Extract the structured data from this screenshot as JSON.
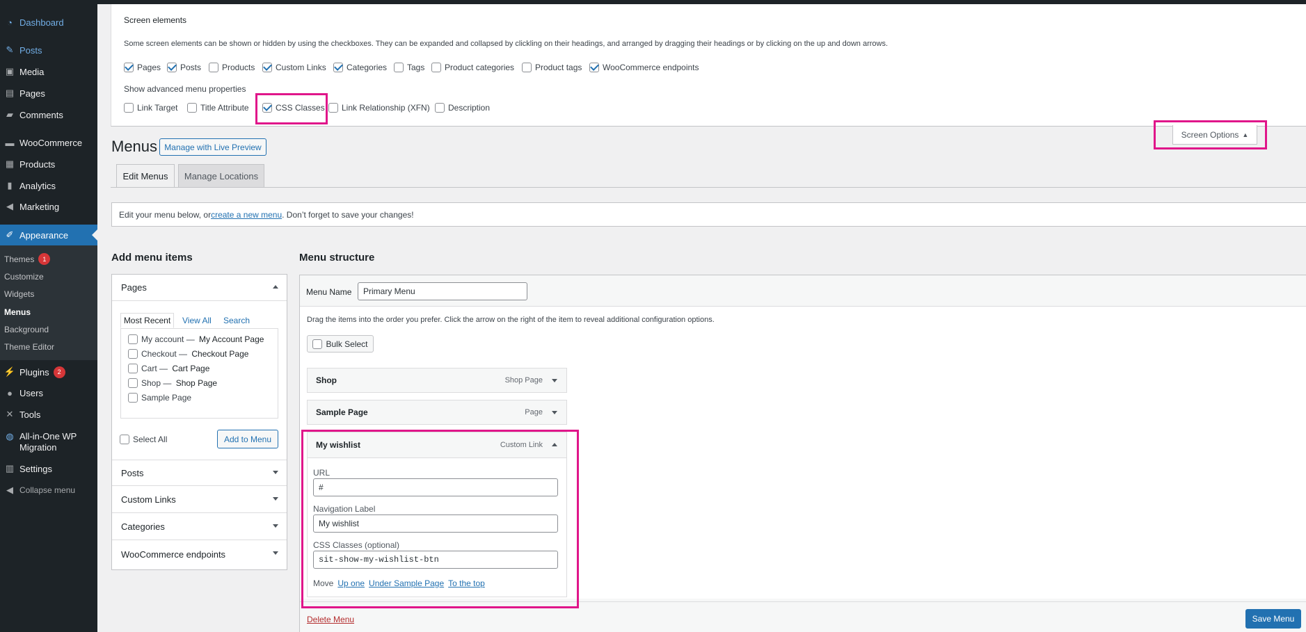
{
  "sidebar": {
    "items": [
      {
        "label": "Dashboard",
        "icon": "dashboard-icon"
      },
      {
        "label": "Posts",
        "icon": "pin-icon"
      },
      {
        "label": "Media",
        "icon": "media-icon"
      },
      {
        "label": "Pages",
        "icon": "pages-icon"
      },
      {
        "label": "Comments",
        "icon": "comment-icon"
      },
      {
        "label": "WooCommerce",
        "icon": "woo-icon"
      },
      {
        "label": "Products",
        "icon": "archive-icon"
      },
      {
        "label": "Analytics",
        "icon": "chart-icon"
      },
      {
        "label": "Marketing",
        "icon": "megaphone-icon"
      },
      {
        "label": "Appearance",
        "icon": "brush-icon"
      },
      {
        "label": "Plugins",
        "icon": "plugin-icon",
        "badge": "2"
      },
      {
        "label": "Users",
        "icon": "user-icon"
      },
      {
        "label": "Tools",
        "icon": "wrench-icon"
      },
      {
        "label": "All-in-One WP Migration",
        "icon": "migration-icon"
      },
      {
        "label": "Settings",
        "icon": "settings-icon"
      },
      {
        "label": "Collapse menu",
        "icon": "collapse-icon"
      }
    ],
    "appearance_sub": [
      {
        "label": "Themes",
        "badge": "1"
      },
      {
        "label": "Customize"
      },
      {
        "label": "Widgets"
      },
      {
        "label": "Menus"
      },
      {
        "label": "Background"
      },
      {
        "label": "Theme Editor"
      }
    ]
  },
  "screen_options": {
    "title": "Screen elements",
    "description": "Some screen elements can be shown or hidden by using the checkboxes. They can be expanded and collapsed by clickling on their headings, and arranged by dragging their headings or by clicking on the up and down arrows.",
    "elements": [
      {
        "label": "Pages",
        "checked": true
      },
      {
        "label": "Posts",
        "checked": true
      },
      {
        "label": "Products",
        "checked": false
      },
      {
        "label": "Custom Links",
        "checked": true
      },
      {
        "label": "Categories",
        "checked": true
      },
      {
        "label": "Tags",
        "checked": false
      },
      {
        "label": "Product categories",
        "checked": false
      },
      {
        "label": "Product tags",
        "checked": false
      },
      {
        "label": "WooCommerce endpoints",
        "checked": true
      }
    ],
    "advanced_title": "Show advanced menu properties",
    "advanced": [
      {
        "label": "Link Target",
        "checked": false
      },
      {
        "label": "Title Attribute",
        "checked": false
      },
      {
        "label": "CSS Classes",
        "checked": true
      },
      {
        "label": "Link Relationship (XFN)",
        "checked": false
      },
      {
        "label": "Description",
        "checked": false
      }
    ],
    "toggle_label": "Screen Options"
  },
  "header": {
    "title": "Menus",
    "live_preview": "Manage with Live Preview",
    "tabs": [
      "Edit Menus",
      "Manage Locations"
    ]
  },
  "notice": {
    "before": "Edit your menu below, or ",
    "link": "create a new menu",
    "after": ". Don’t forget to save your changes!"
  },
  "add_items": {
    "title": "Add menu items",
    "pages_title": "Pages",
    "inner_tabs": [
      "Most Recent",
      "View All",
      "Search"
    ],
    "pages": [
      {
        "name": "My account",
        "sep": " — ",
        "state": "My Account Page"
      },
      {
        "name": "Checkout",
        "sep": " — ",
        "state": "Checkout Page"
      },
      {
        "name": "Cart",
        "sep": " — ",
        "state": "Cart Page"
      },
      {
        "name": "Shop",
        "sep": " — ",
        "state": "Shop Page"
      },
      {
        "name": "Sample Page",
        "sep": "",
        "state": ""
      }
    ],
    "select_all": "Select All",
    "add_to_menu": "Add to Menu",
    "sections": [
      "Posts",
      "Custom Links",
      "Categories",
      "WooCommerce endpoints"
    ]
  },
  "structure": {
    "title": "Menu structure",
    "menu_name_label": "Menu Name",
    "menu_name": "Primary Menu",
    "instructions": "Drag the items into the order you prefer. Click the arrow on the right of the item to reveal additional configuration options.",
    "bulk_select": "Bulk Select",
    "items": [
      {
        "title": "Shop",
        "type": "Shop Page"
      },
      {
        "title": "Sample Page",
        "type": "Page"
      },
      {
        "title": "My wishlist",
        "type": "Custom Link"
      }
    ],
    "expanded": {
      "url_label": "URL",
      "url": "#",
      "nav_label_label": "Navigation Label",
      "nav_label": "My wishlist",
      "css_label": "CSS Classes (optional)",
      "css": "sit-show-my-wishlist-btn",
      "move_label": "Move",
      "move_links": [
        "Up one",
        "Under Sample Page",
        "To the top"
      ]
    },
    "delete": "Delete Menu",
    "save": "Save Menu"
  },
  "colors": {
    "accent": "#2271b1",
    "highlight": "#e0168a",
    "sidebar": "#1d2327"
  }
}
